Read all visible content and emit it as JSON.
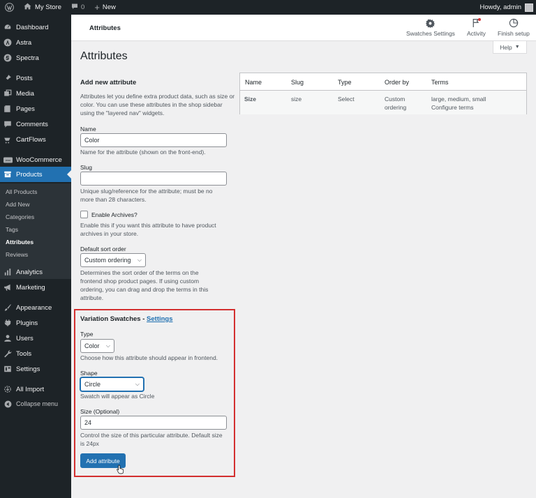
{
  "adminbar": {
    "site_name": "My Store",
    "comments_count": "0",
    "new_label": "New",
    "greeting": "Howdy, admin"
  },
  "sidebar": {
    "items": [
      {
        "label": "Dashboard",
        "icon": "dashboard-icon"
      },
      {
        "label": "Astra",
        "icon": "astra-icon"
      },
      {
        "label": "Spectra",
        "icon": "spectra-icon"
      },
      {
        "label": "Posts",
        "icon": "pin-icon"
      },
      {
        "label": "Media",
        "icon": "media-icon"
      },
      {
        "label": "Pages",
        "icon": "pages-icon"
      },
      {
        "label": "Comments",
        "icon": "comment-icon"
      },
      {
        "label": "CartFlows",
        "icon": "cartflows-icon"
      },
      {
        "label": "WooCommerce",
        "icon": "woo-icon"
      },
      {
        "label": "Products",
        "icon": "archive-icon"
      },
      {
        "label": "Analytics",
        "icon": "bar-chart-icon"
      },
      {
        "label": "Marketing",
        "icon": "megaphone-icon"
      },
      {
        "label": "Appearance",
        "icon": "brush-icon"
      },
      {
        "label": "Plugins",
        "icon": "plug-icon"
      },
      {
        "label": "Users",
        "icon": "user-icon"
      },
      {
        "label": "Tools",
        "icon": "wrench-icon"
      },
      {
        "label": "Settings",
        "icon": "settings-icon"
      },
      {
        "label": "All Import",
        "icon": "import-icon"
      },
      {
        "label": "Collapse menu",
        "icon": "collapse-icon"
      }
    ],
    "submenu": [
      "All Products",
      "Add New",
      "Categories",
      "Tags",
      "Attributes",
      "Reviews"
    ]
  },
  "wc_header": {
    "title": "Attributes",
    "actions": [
      {
        "label": "Swatches Settings",
        "icon": "gear-icon"
      },
      {
        "label": "Activity",
        "icon": "flag-icon"
      },
      {
        "label": "Finish setup",
        "icon": "progress-icon"
      }
    ]
  },
  "help_label": "Help",
  "page_title": "Attributes",
  "form": {
    "heading": "Add new attribute",
    "intro": "Attributes let you define extra product data, such as size or color. You can use these attributes in the shop sidebar using the \"layered nav\" widgets.",
    "name_label": "Name",
    "name_value": "Color",
    "name_help": "Name for the attribute (shown on the front-end).",
    "slug_label": "Slug",
    "slug_value": "",
    "slug_help": "Unique slug/reference for the attribute; must be no more than 28 characters.",
    "archives_label": "Enable Archives?",
    "archives_help": "Enable this if you want this attribute to have product archives in your store.",
    "sort_label": "Default sort order",
    "sort_value": "Custom ordering",
    "sort_help": "Determines the sort order of the terms on the frontend shop product pages. If using custom ordering, you can drag and drop the terms in this attribute."
  },
  "swatches": {
    "heading": "Variation Swatches - ",
    "settings_link": "Settings",
    "type_label": "Type",
    "type_value": "Color",
    "type_help": "Choose how this attribute should appear in frontend.",
    "shape_label": "Shape",
    "shape_value": "Circle",
    "shape_help": "Swatch will appear as Circle",
    "size_label": "Size (Optional)",
    "size_value": "24",
    "size_help": "Control the size of this particular attribute. Default size is 24px",
    "submit_label": "Add attribute",
    "highlight_color": "#d32f2f"
  },
  "table": {
    "headers": [
      "Name",
      "Slug",
      "Type",
      "Order by",
      "Terms"
    ],
    "rows": [
      {
        "name": "Size",
        "slug": "size",
        "type": "Select",
        "order_by": "Custom ordering",
        "terms": "large, medium, small",
        "configure": "Configure terms"
      }
    ]
  },
  "colors": {
    "admin_bg": "#1d2327",
    "accent": "#2271b1",
    "page_bg": "#f0f0f1"
  }
}
